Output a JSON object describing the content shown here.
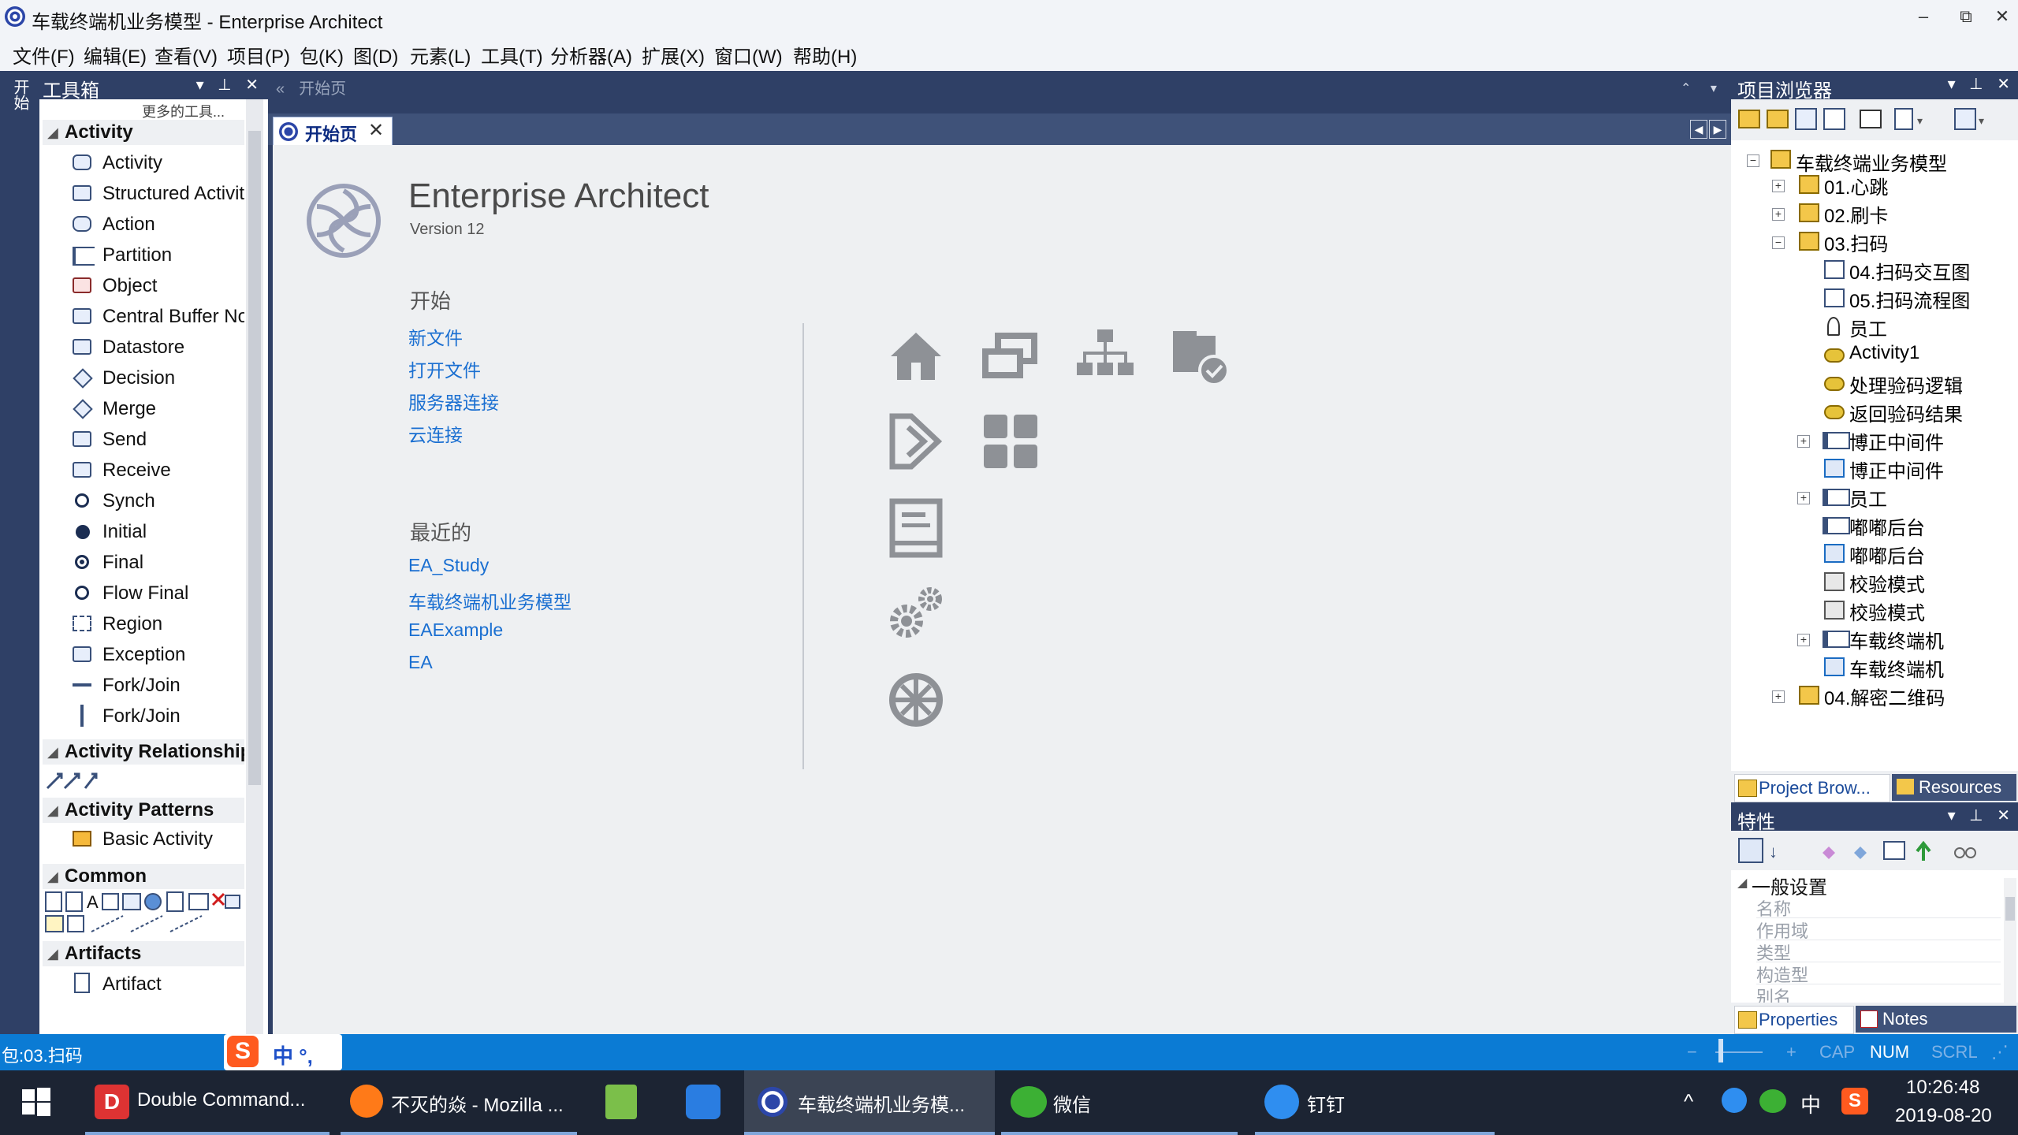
{
  "window": {
    "title": "车载终端机业务模型 - Enterprise Architect",
    "controls": [
      "–",
      "⧉",
      "✕"
    ]
  },
  "menubar": {
    "items": [
      "文件(F)",
      "编辑(E)",
      "查看(V)",
      "项目(P)",
      "包(K)",
      "图(D)",
      "元素(L)",
      "工具(T)",
      "分析器(A)",
      "扩展(X)",
      "窗口(W)",
      "帮助(H)"
    ]
  },
  "leftstrip": {
    "tab_label": "开始"
  },
  "toolbox": {
    "title": "工具箱",
    "hint": "更多的工具...",
    "sections": [
      {
        "label": "Activity",
        "items": [
          "Activity",
          "Structured Activity",
          "Action",
          "Partition",
          "Object",
          "Central Buffer Node",
          "Datastore",
          "Decision",
          "Merge",
          "Send",
          "Receive",
          "Synch",
          "Initial",
          "Final",
          "Flow Final",
          "Region",
          "Exception",
          "Fork/Join",
          "Fork/Join"
        ]
      },
      {
        "label": "Activity Relationships",
        "items": []
      },
      {
        "label": "Activity Patterns",
        "items": [
          "Basic Activity"
        ]
      },
      {
        "label": "Common",
        "items": []
      },
      {
        "label": "Artifacts",
        "items": [
          "Artifact"
        ]
      }
    ]
  },
  "document": {
    "crumb": "开始页",
    "tab": {
      "label": "开始页",
      "close": "✕"
    },
    "app_name": "Enterprise Architect",
    "version": "Version 12",
    "start": {
      "title": "开始",
      "links": [
        "新文件",
        "打开文件",
        "服务器连接",
        "云连接"
      ]
    },
    "recent": {
      "title": "最近的",
      "links": [
        "EA_Study",
        "车载终端机业务模型",
        "EAExample",
        "EA"
      ]
    }
  },
  "project_browser": {
    "title": "项目浏览器",
    "root": "车载终端业务模型",
    "nodes": [
      {
        "label": "01.心跳",
        "expander": "+"
      },
      {
        "label": "02.刷卡",
        "expander": "+"
      },
      {
        "label": "03.扫码",
        "expander": "−"
      },
      {
        "label": "04.扫码交互图",
        "expander": ""
      },
      {
        "label": "05.扫码流程图",
        "expander": ""
      },
      {
        "label": "员工",
        "expander": ""
      },
      {
        "label": "Activity1",
        "expander": ""
      },
      {
        "label": "处理验码逻辑",
        "expander": ""
      },
      {
        "label": "返回验码结果",
        "expander": ""
      },
      {
        "label": "博正中间件",
        "expander": "+"
      },
      {
        "label": "博正中间件",
        "expander": ""
      },
      {
        "label": "员工",
        "expander": "+"
      },
      {
        "label": "嘟嘟后台",
        "expander": ""
      },
      {
        "label": "嘟嘟后台",
        "expander": ""
      },
      {
        "label": "校验模式",
        "expander": ""
      },
      {
        "label": "校验模式",
        "expander": ""
      },
      {
        "label": "车载终端机",
        "expander": "+"
      },
      {
        "label": "车载终端机",
        "expander": ""
      },
      {
        "label": "04.解密二维码",
        "expander": "+"
      }
    ],
    "tabs": [
      "Project Brow...",
      "Resources"
    ]
  },
  "properties": {
    "title": "特性",
    "group": "一般设置",
    "rows": [
      "名称",
      "作用域",
      "类型",
      "构造型",
      "别名"
    ],
    "tabs": [
      "Properties",
      "Notes"
    ]
  },
  "statusbar": {
    "left": "包:03.扫码",
    "ime": "中 °,",
    "indicators": [
      "CAP",
      "NUM",
      "SCRL"
    ],
    "zoom_minus": "−",
    "zoom_plus": "+"
  },
  "taskbar": {
    "apps": [
      "Double Command...",
      "不灭的焱 - Mozilla ...",
      "",
      "",
      "车载终端机业务模...",
      "微信",
      "钉钉"
    ],
    "tray": [
      "^",
      "中"
    ],
    "time": "10:26:48",
    "date": "2019-08-20"
  },
  "colors": {
    "chrome_dark": "#2f4066",
    "link_blue": "#1a6fd1",
    "status_blue": "#0b7bd4",
    "taskbar": "#1c2433"
  }
}
